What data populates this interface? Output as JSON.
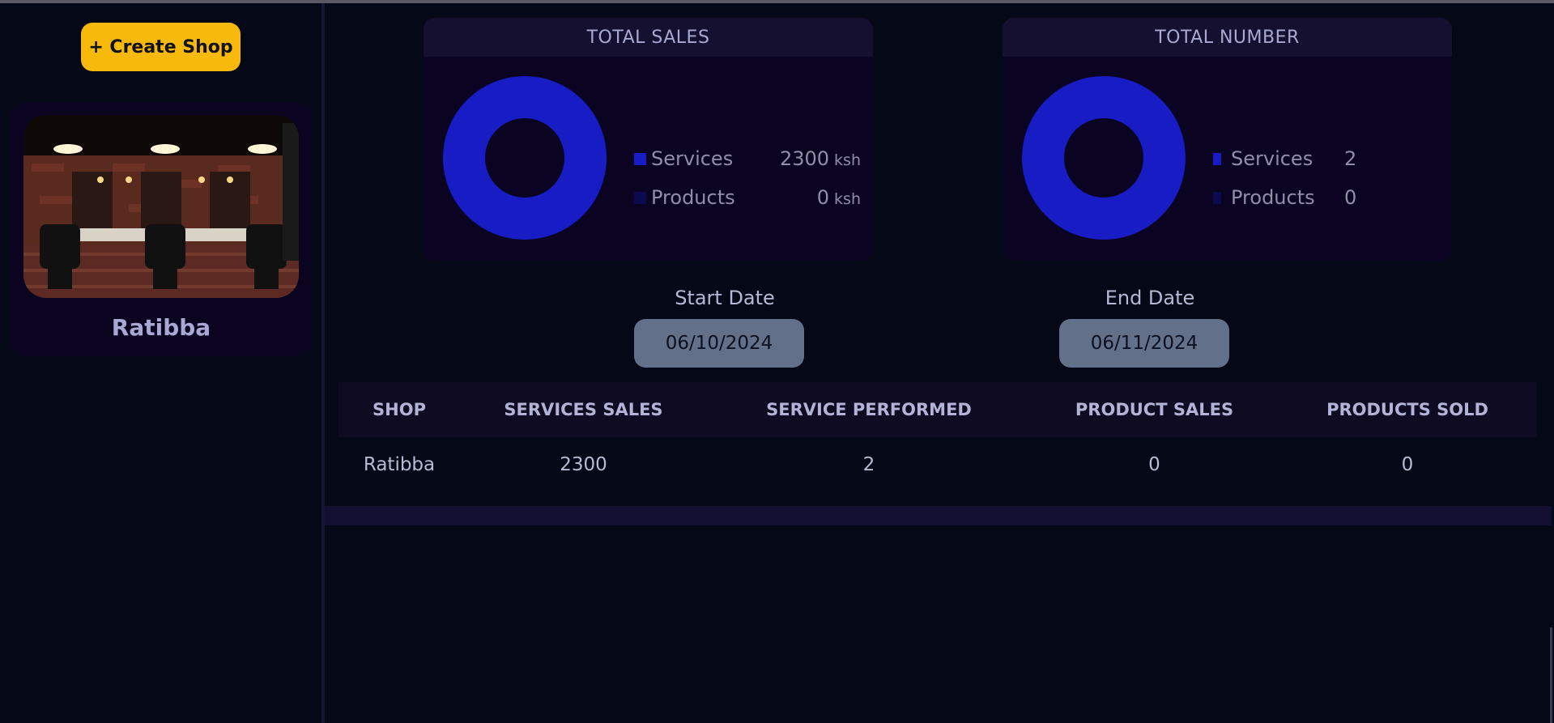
{
  "sidebar": {
    "create_button": "+ Create Shop",
    "shop": {
      "name": "Ratibba"
    }
  },
  "total_sales": {
    "title": "TOTAL SALES",
    "items": [
      {
        "label": "Services",
        "value": "2300",
        "unit": "ksh",
        "color": "#171cc4"
      },
      {
        "label": "Products",
        "value": "0",
        "unit": "ksh",
        "color": "#0c0a4e"
      }
    ]
  },
  "total_number": {
    "title": "TOTAL NUMBER",
    "items": [
      {
        "label": "Services",
        "value": "2",
        "color": "#171cc4"
      },
      {
        "label": "Products",
        "value": "0",
        "color": "#0c0a4e"
      }
    ]
  },
  "filters": {
    "start_label": "Start Date",
    "start_value": "06/10/2024",
    "end_label": "End Date",
    "end_value": "06/11/2024"
  },
  "table": {
    "headers": [
      "SHOP",
      "SERVICES SALES",
      "SERVICE PERFORMED",
      "PRODUCT SALES",
      "PRODUCTS SOLD"
    ],
    "rows": [
      [
        "Ratibba",
        "2300",
        "2",
        "0",
        "0"
      ]
    ]
  },
  "colors": {
    "accent": "#f7b90b",
    "services": "#171cc4",
    "products": "#0c0a4e",
    "background": "#050816"
  }
}
